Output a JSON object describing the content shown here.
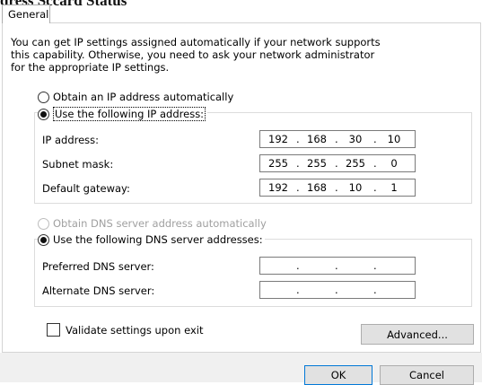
{
  "window": {
    "title": "dress Sccard Status"
  },
  "tabs": [
    {
      "label": "General"
    }
  ],
  "description": [
    "You can get IP settings assigned automatically if your network supports",
    "this capability. Otherwise, you need to ask your network administrator",
    "for the appropriate IP settings."
  ],
  "ip": {
    "auto_label": "Obtain an IP address automatically",
    "manual_label": "Use the following IP address:",
    "fields": [
      {
        "label": "IP address:",
        "value": [
          "192",
          "168",
          "30",
          "10"
        ]
      },
      {
        "label": "Subnet mask:",
        "value": [
          "255",
          "255",
          "255",
          "0"
        ]
      },
      {
        "label": "Default gateway:",
        "value": [
          "192",
          "168",
          "10",
          "1"
        ]
      }
    ]
  },
  "dns": {
    "auto_label": "Obtain DNS server address automatically",
    "manual_label": "Use the following DNS server addresses:",
    "fields": [
      {
        "label": "Preferred DNS server:",
        "value": [
          "",
          "",
          "",
          ""
        ]
      },
      {
        "label": "Alternate DNS server:",
        "value": [
          "",
          "",
          "",
          ""
        ]
      }
    ]
  },
  "validate_label": "Validate settings upon exit",
  "buttons": {
    "advanced": "Advanced...",
    "ok": "OK",
    "cancel": "Cancel"
  },
  "colors": {
    "default_button_border": "#0078d7",
    "footer_bg": "#f0f0f0",
    "disabled_text": "#a0a0a0"
  }
}
